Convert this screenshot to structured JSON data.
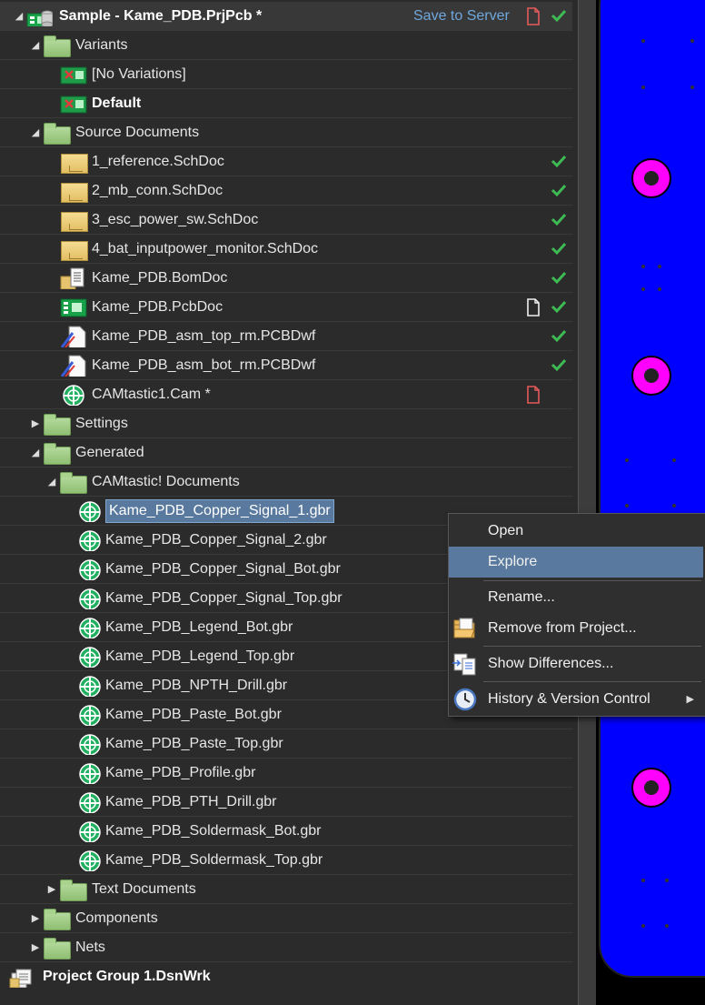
{
  "project": {
    "title": "Sample - Kame_PDB.PrjPcb *",
    "save_to_server": "Save to Server"
  },
  "tree": {
    "variants": "Variants",
    "no_variations": "[No Variations]",
    "default": "Default",
    "source_documents": "Source Documents",
    "source_files": [
      "1_reference.SchDoc",
      "2_mb_conn.SchDoc",
      "3_esc_power_sw.SchDoc",
      "4_bat_inputpower_monitor.SchDoc",
      "Kame_PDB.BomDoc",
      "Kame_PDB.PcbDoc",
      "Kame_PDB_asm_top_rm.PCBDwf",
      "Kame_PDB_asm_bot_rm.PCBDwf",
      "CAMtastic1.Cam *"
    ],
    "settings": "Settings",
    "generated": "Generated",
    "camtastic_documents": "CAMtastic! Documents",
    "gerber_files": [
      "Kame_PDB_Copper_Signal_1.gbr",
      "Kame_PDB_Copper_Signal_2.gbr",
      "Kame_PDB_Copper_Signal_Bot.gbr",
      "Kame_PDB_Copper_Signal_Top.gbr",
      "Kame_PDB_Legend_Bot.gbr",
      "Kame_PDB_Legend_Top.gbr",
      "Kame_PDB_NPTH_Drill.gbr",
      "Kame_PDB_Paste_Bot.gbr",
      "Kame_PDB_Paste_Top.gbr",
      "Kame_PDB_Profile.gbr",
      "Kame_PDB_PTH_Drill.gbr",
      "Kame_PDB_Soldermask_Bot.gbr",
      "Kame_PDB_Soldermask_Top.gbr"
    ],
    "text_documents": "Text Documents",
    "components": "Components",
    "nets": "Nets",
    "project_group": "Project Group 1.DsnWrk"
  },
  "context_menu": {
    "open": "Open",
    "explore": "Explore",
    "rename": "Rename...",
    "remove": "Remove from Project...",
    "show_differences": "Show Differences...",
    "history": "History & Version Control"
  },
  "colors": {
    "selection": "#597a9e",
    "check": "#3dbb55",
    "pcb_board": "#0000ff",
    "pcb_pad": "#ff00ff"
  }
}
